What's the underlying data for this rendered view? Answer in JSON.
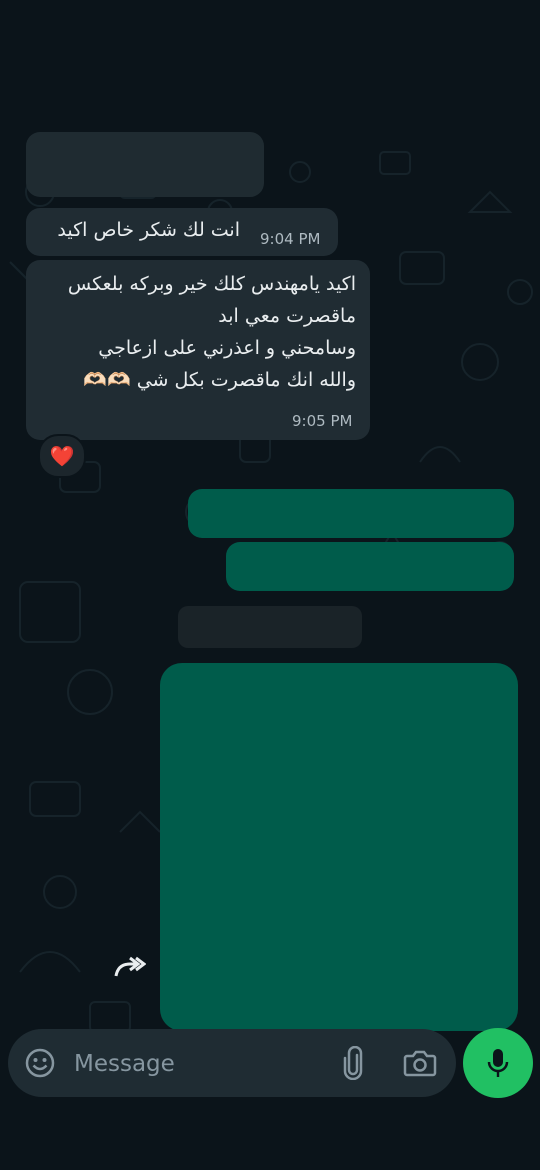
{
  "messages": [
    {
      "text": "انت لك شكر خاص اكيد",
      "time": "9:04 PM"
    },
    {
      "lines": [
        "اكيد يامهندس كلك خير وبركه بلعكس",
        "ماقصرت معي ابد",
        "وسامحني و اعذرني على ازعاجي",
        "والله انك ماقصرت بكل شي 🫶🏻🫶🏻"
      ],
      "time": "9:05 PM",
      "reaction": "❤️"
    }
  ],
  "composer": {
    "placeholder": "Message"
  },
  "icons": {
    "emoji": "emoji-icon",
    "attach": "paperclip-icon",
    "camera": "camera-icon",
    "mic": "microphone-icon",
    "forward": "forward-icon"
  },
  "colors": {
    "background": "#0b141a",
    "incoming_bubble": "#202c33",
    "outgoing_bubble": "#005c4b",
    "mic_button": "#21c063"
  }
}
